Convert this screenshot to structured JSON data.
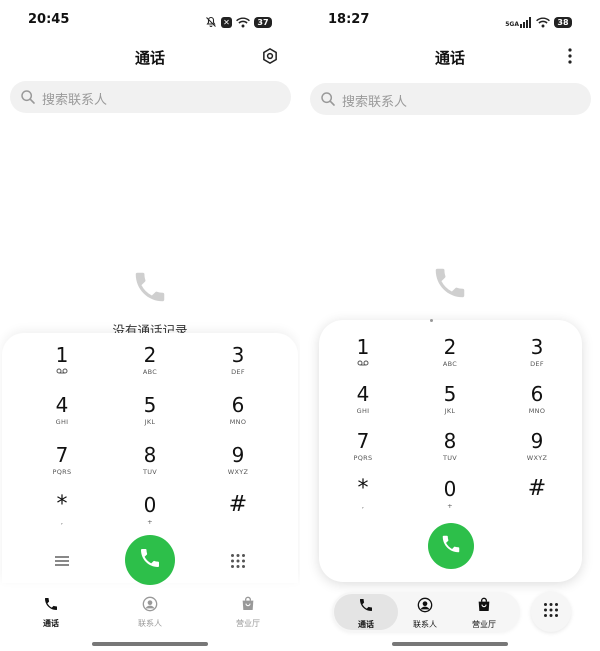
{
  "colors": {
    "call_green": "#2dbf4a",
    "search_bg": "#f1f1f1",
    "placeholder": "#9a9a9a"
  },
  "left": {
    "status": {
      "time": "20:45",
      "battery": "37",
      "icons": [
        "mute-icon",
        "x-badge-icon",
        "wifi-icon",
        "battery-icon"
      ]
    },
    "title": "通话",
    "title_action_icon": "settings-icon",
    "search": {
      "placeholder": "搜索联系人"
    },
    "empty_state": {
      "icon": "phone-icon",
      "text": "没有通话记录"
    },
    "keypad": [
      {
        "digit": "1",
        "letters": "voicemail-icon"
      },
      {
        "digit": "2",
        "letters": "ABC"
      },
      {
        "digit": "3",
        "letters": "DEF"
      },
      {
        "digit": "4",
        "letters": "GHI"
      },
      {
        "digit": "5",
        "letters": "JKL"
      },
      {
        "digit": "6",
        "letters": "MNO"
      },
      {
        "digit": "7",
        "letters": "PQRS"
      },
      {
        "digit": "8",
        "letters": "TUV"
      },
      {
        "digit": "9",
        "letters": "WXYZ"
      },
      {
        "digit": "*",
        "letters": ","
      },
      {
        "digit": "0",
        "letters": "+"
      },
      {
        "digit": "#",
        "letters": ""
      }
    ],
    "bottom_controls": {
      "menu_icon": "menu-icon",
      "call_icon": "call-icon",
      "dialpad_icon": "dialpad-icon"
    },
    "tabs": [
      {
        "label": "通话",
        "icon": "phone-tab-icon",
        "active": true
      },
      {
        "label": "联系人",
        "icon": "contacts-tab-icon",
        "active": false
      },
      {
        "label": "营业厅",
        "icon": "store-tab-icon",
        "active": false
      }
    ]
  },
  "right": {
    "status": {
      "time": "18:27",
      "battery": "38",
      "network": "5GA",
      "icons": [
        "signal-icon",
        "wifi-icon",
        "battery-icon"
      ]
    },
    "title": "通话",
    "title_action_icon": "more-icon",
    "search": {
      "placeholder": "搜索联系人"
    },
    "empty_state": {
      "icon": "phone-icon"
    },
    "keypad": [
      {
        "digit": "1",
        "letters": "voicemail-icon"
      },
      {
        "digit": "2",
        "letters": "ABC"
      },
      {
        "digit": "3",
        "letters": "DEF"
      },
      {
        "digit": "4",
        "letters": "GHI"
      },
      {
        "digit": "5",
        "letters": "JKL"
      },
      {
        "digit": "6",
        "letters": "MNO"
      },
      {
        "digit": "7",
        "letters": "PQRS"
      },
      {
        "digit": "8",
        "letters": "TUV"
      },
      {
        "digit": "9",
        "letters": "WXYZ"
      },
      {
        "digit": "*",
        "letters": ","
      },
      {
        "digit": "0",
        "letters": "+"
      },
      {
        "digit": "#",
        "letters": ""
      }
    ],
    "bottom_controls": {
      "call_icon": "call-icon",
      "dialpad_icon": "dialpad-icon"
    },
    "tabs": [
      {
        "label": "通话",
        "icon": "phone-tab-icon",
        "active": true
      },
      {
        "label": "联系人",
        "icon": "contacts-tab-icon",
        "active": false
      },
      {
        "label": "营业厅",
        "icon": "store-tab-icon",
        "active": false
      }
    ]
  }
}
